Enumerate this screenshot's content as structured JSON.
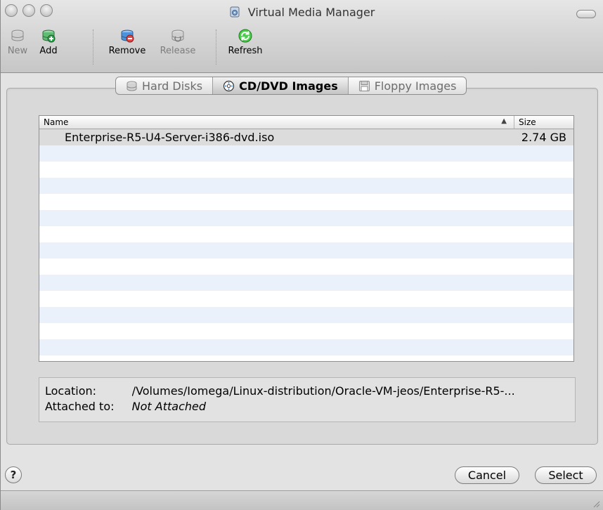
{
  "window": {
    "title": "Virtual Media Manager"
  },
  "toolbar": {
    "items": [
      {
        "label": "New",
        "icon": "disk-new-icon",
        "enabled": false
      },
      {
        "label": "Add",
        "icon": "disk-add-icon",
        "enabled": true
      },
      {
        "label": "Remove",
        "icon": "disk-remove-icon",
        "enabled": true
      },
      {
        "label": "Release",
        "icon": "disk-release-icon",
        "enabled": false
      },
      {
        "label": "Refresh",
        "icon": "refresh-icon",
        "enabled": true
      }
    ]
  },
  "tabs": [
    {
      "label": "Hard Disks",
      "icon": "hard-disk-icon",
      "active": false
    },
    {
      "label": "CD/DVD Images",
      "icon": "cd-dvd-icon",
      "active": true
    },
    {
      "label": "Floppy Images",
      "icon": "floppy-icon",
      "active": false
    }
  ],
  "list": {
    "columns": {
      "name": "Name",
      "size": "Size"
    },
    "sort_indicator": "▲",
    "rows": [
      {
        "name": "Enterprise-R5-U4-Server-i386-dvd.iso",
        "size": "2.74 GB",
        "selected": true
      }
    ]
  },
  "details": {
    "location_label": "Location:",
    "location_value": "/Volumes/Iomega/Linux-distribution/Oracle-VM-jeos/Enterprise-R5-...",
    "attached_label": "Attached to:",
    "attached_value": "Not Attached"
  },
  "buttons": {
    "help": "?",
    "cancel": "Cancel",
    "select": "Select"
  },
  "colors": {
    "alt_row": "#eaf1fb",
    "selected_row": "#dcdcdc",
    "add_green": "#2fa84f",
    "remove_blue": "#2f7fd6",
    "refresh_green": "#2fbf2f"
  }
}
